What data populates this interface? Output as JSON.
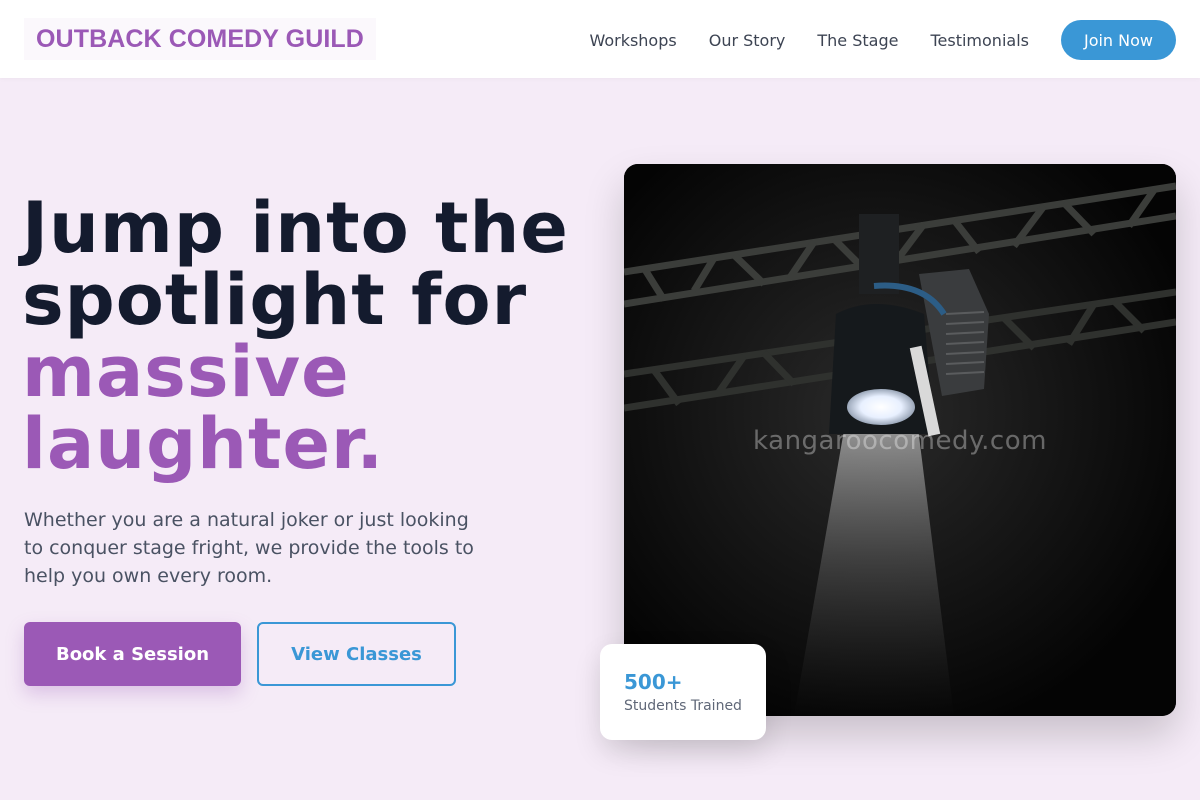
{
  "header": {
    "brand": "OUTBACK COMEDY GUILD",
    "nav": [
      {
        "label": "Workshops"
      },
      {
        "label": "Our Story"
      },
      {
        "label": "The Stage"
      },
      {
        "label": "Testimonials"
      }
    ],
    "cta_label": "Join Now"
  },
  "hero": {
    "title_line1": "Jump into the",
    "title_line2": "spotlight for",
    "title_accent_line1": "massive",
    "title_accent_line2": "laughter.",
    "subtitle": "Whether you are a natural joker or just looking to conquer stage fright, we provide the tools to help you own every room.",
    "primary_button": "Book a Session",
    "secondary_button": "View Classes",
    "image_watermark": "kangaroocomedy.com"
  },
  "stat": {
    "number": "500+",
    "label": "Students Trained"
  },
  "colors": {
    "accent_purple": "#9b59b6",
    "accent_blue": "#3a97d6",
    "background": "#f5ebf7",
    "heading": "#141b2e"
  }
}
